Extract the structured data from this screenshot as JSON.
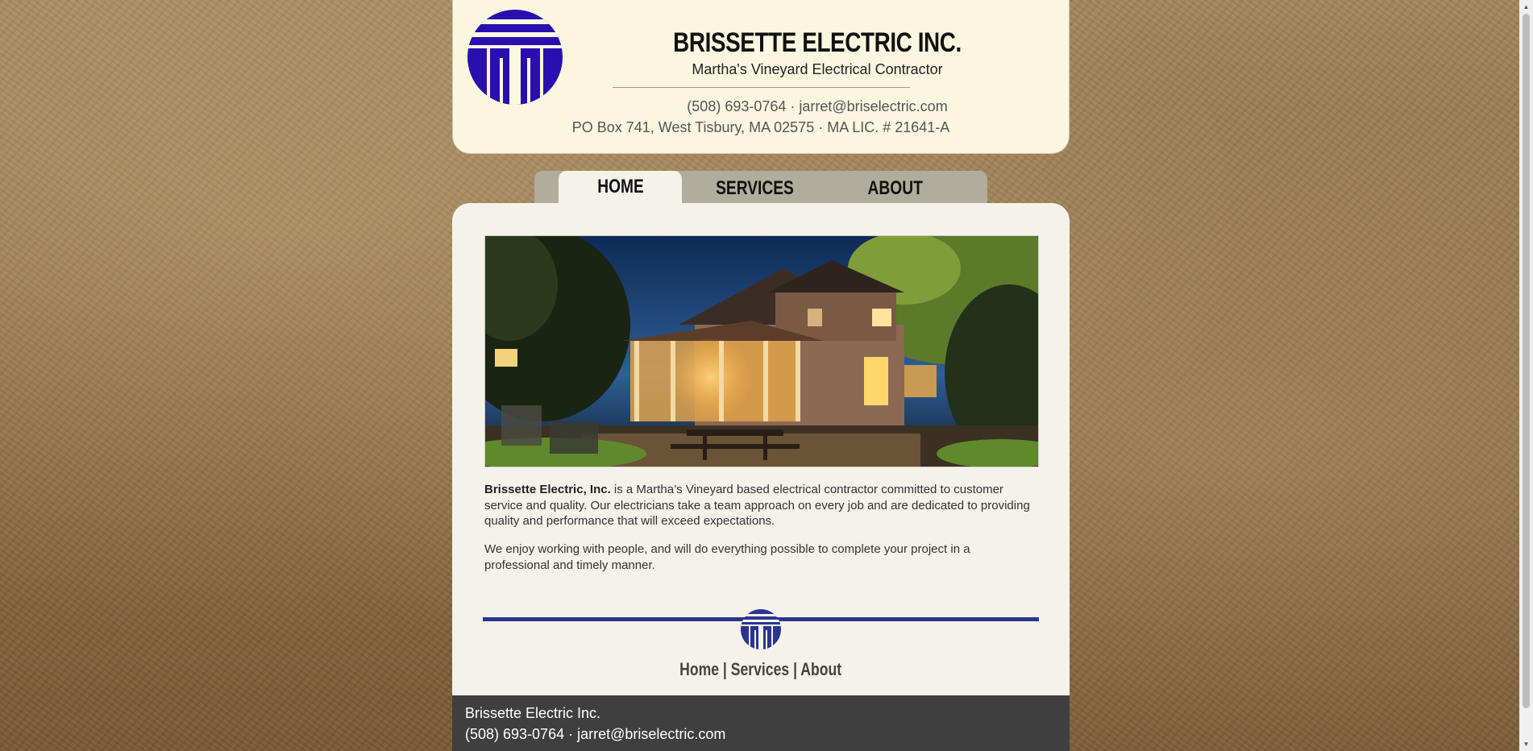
{
  "header": {
    "company_name": "BRISSETTE ELECTRIC INC.",
    "tagline": "Martha's Vineyard Electrical Contractor",
    "contact_line": "(508) 693-0764 · jarret@briselectric.com",
    "address_line": "PO Box 741, West Tisbury, MA 02575 · MA LIC. # 21641-A"
  },
  "nav": {
    "tabs": [
      {
        "label": "HOME",
        "active": true
      },
      {
        "label": "SERVICES",
        "active": false
      },
      {
        "label": "ABOUT",
        "active": false
      }
    ]
  },
  "main": {
    "intro_bold": "Brissette Electric, Inc.",
    "intro_rest": " is a Martha’s Vineyard based electrical contractor committed to customer service and quality. Our electricians take a team approach on every job and are dedicated to providing quality and performance that will exceed expectations.",
    "second_paragraph": "We enjoy working with people, and will do everything possible to complete your project in a professional and timely manner."
  },
  "footer": {
    "links": [
      "Home",
      "Services",
      "About"
    ],
    "separator": "|",
    "company_name": "Brissette Electric Inc.",
    "contact_line": "(508) 693-0764 · jarret@briselectric.com"
  },
  "colors": {
    "brand_blue": "#2a0fb0",
    "rule_blue": "#2a3591",
    "header_bg": "#fbf6e0",
    "content_bg": "#f5f2ea",
    "bottom_bar_bg": "#3f3f3f"
  },
  "icons": {
    "logo": "brissette-logo-icon",
    "footer_logo": "brissette-small-logo-icon"
  }
}
